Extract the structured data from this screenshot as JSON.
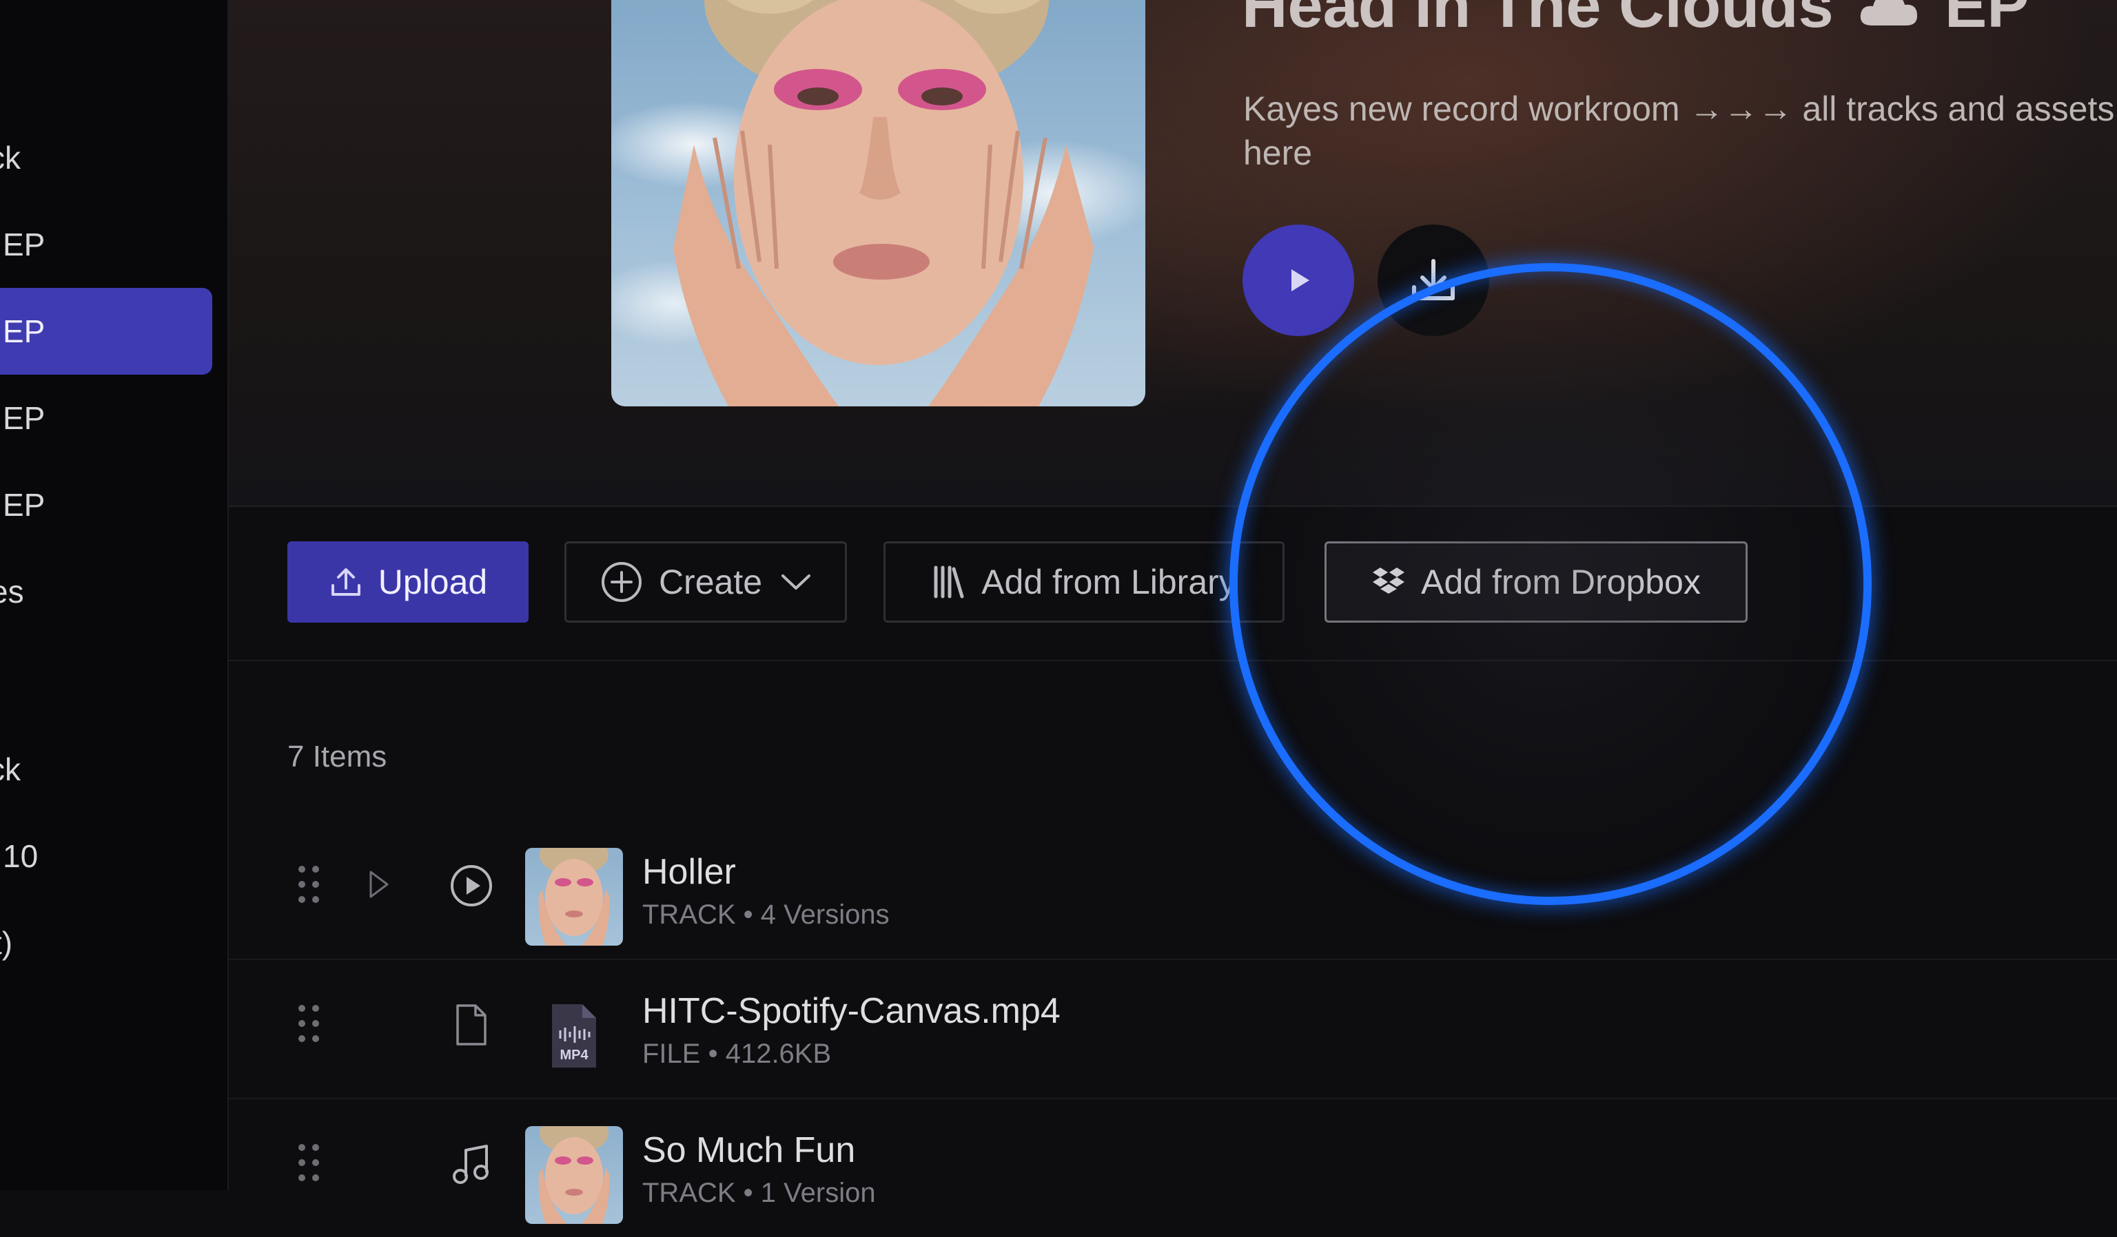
{
  "sidebar": {
    "items": [
      {
        "label": "ck"
      },
      {
        "label": "EP"
      },
      {
        "label": "EP",
        "active": true
      },
      {
        "label": "EP"
      },
      {
        "label": "EP"
      },
      {
        "label": "es"
      },
      {
        "label": "ck"
      },
      {
        "label": "10"
      },
      {
        "label": "t)"
      }
    ]
  },
  "hero": {
    "title_part1": "Head In The Clouds",
    "title_part2": "EP",
    "description": "Kayes new record workroom →→→ all tracks and assets live here",
    "play_icon": "play-icon",
    "download_icon": "download-icon"
  },
  "toolbar": {
    "upload_label": "Upload",
    "create_label": "Create",
    "library_label": "Add from Library",
    "dropbox_label": "Add from Dropbox"
  },
  "list": {
    "count_label": "7 Items",
    "rows": [
      {
        "title": "Holler",
        "meta": "TRACK • 4 Versions",
        "type_icon": "play-circle-icon"
      },
      {
        "title": "HITC-Spotify-Canvas.mp4",
        "meta": "FILE • 412.6KB",
        "type_icon": "file-icon",
        "thumb_label": "MP4"
      },
      {
        "title": "So Much Fun",
        "meta": "TRACK • 1 Version",
        "type_icon": "music-note-icon"
      }
    ]
  },
  "colors": {
    "accent": "#3f3bb0",
    "spotlight": "#1a6dff",
    "background": "#0d0d10"
  }
}
